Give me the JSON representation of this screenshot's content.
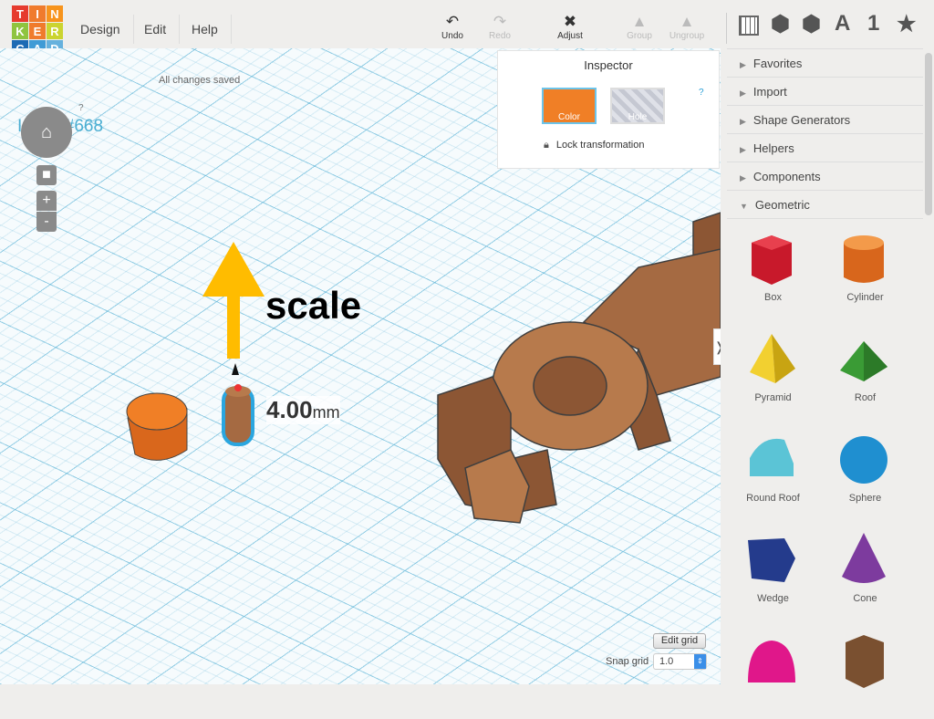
{
  "logo": {
    "letters": [
      "T",
      "I",
      "N",
      "K",
      "E",
      "R",
      "C",
      "A",
      "D"
    ],
    "colors": [
      "#e63b2e",
      "#f07b2c",
      "#f7941d",
      "#8fc43f",
      "#f07b2c",
      "#cbd430",
      "#1d6ab4",
      "#3f9bd6",
      "#66b1dd"
    ]
  },
  "menu": {
    "design": "Design",
    "edit": "Edit",
    "help": "Help"
  },
  "toolbar": {
    "undo": "Undo",
    "redo": "Redo",
    "adjust": "Adjust",
    "group": "Group",
    "ungroup": "Ungroup"
  },
  "view_icons": {
    "a": "A",
    "one": "1",
    "star": "★"
  },
  "project": {
    "title": "Ignite #668",
    "status": "All changes saved"
  },
  "nav": {
    "help": "?",
    "zoom_in": "+",
    "zoom_out": "-"
  },
  "inspector": {
    "title": "Inspector",
    "color": "Color",
    "hole": "Hole",
    "help": "?",
    "lock": "Lock transformation",
    "color_value": "#f07f26"
  },
  "annotation": {
    "text": "scale"
  },
  "dimension": {
    "value": "4.00",
    "unit": "mm"
  },
  "grid": {
    "edit": "Edit grid",
    "snap_label": "Snap grid",
    "snap_value": "1.0"
  },
  "panel": {
    "categories": [
      "Favorites",
      "Import",
      "Shape Generators",
      "Helpers",
      "Components"
    ],
    "open": "Geometric",
    "shapes": [
      "Box",
      "Cylinder",
      "Pyramid",
      "Roof",
      "Round Roof",
      "Sphere",
      "Wedge",
      "Cone",
      "",
      ""
    ]
  },
  "collapse": "❭"
}
